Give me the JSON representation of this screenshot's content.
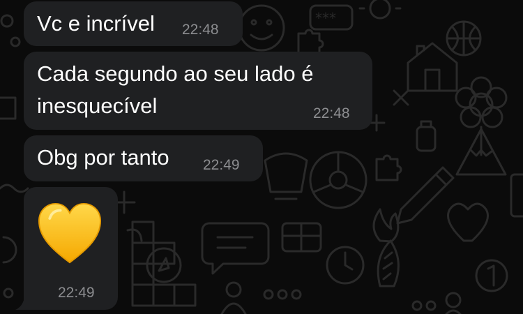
{
  "colors": {
    "background": "#0b0b0b",
    "bubble": "#1f2022",
    "text": "#ffffff",
    "timestamp": "#8c8d90",
    "doodle": "#2a2a2a",
    "heart": "#ffc72e"
  },
  "messages": [
    {
      "lines": [
        "Vc e incrível"
      ],
      "time": "22:48"
    },
    {
      "lines": [
        "Cada segundo ao seu lado é",
        "inesquecível"
      ],
      "time": "22:48"
    },
    {
      "lines": [
        "Obg por tanto"
      ],
      "time": "22:49"
    },
    {
      "emoji": "yellow-heart",
      "time": "22:49"
    }
  ]
}
